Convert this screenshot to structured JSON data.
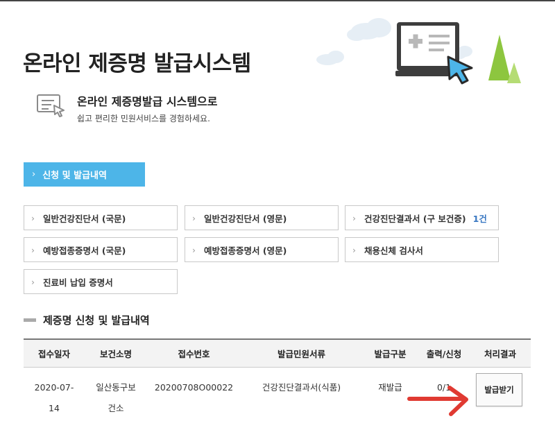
{
  "page": {
    "title": "온라인 제증명 발급시스템"
  },
  "intro": {
    "title": "온라인 제증명발급 시스템으로",
    "subtitle": "쉽고 편리한 민원서비스를 경험하세요."
  },
  "primary_tab": {
    "label": "신청 및 발급내역"
  },
  "certificates": [
    {
      "label": "일반건강진단서 (국문)",
      "count": ""
    },
    {
      "label": "일반건강진단서 (영문)",
      "count": ""
    },
    {
      "label": "건강진단결과서 (구 보건증)",
      "count": "1건"
    },
    {
      "label": "예방접종증명서 (국문)",
      "count": ""
    },
    {
      "label": "예방접종증명서 (영문)",
      "count": ""
    },
    {
      "label": "채용신체 검사서",
      "count": ""
    },
    {
      "label": "진료비 납입 증명서",
      "count": ""
    }
  ],
  "section": {
    "title": "제증명 신청 및 발급내역"
  },
  "table": {
    "headers": [
      "접수일자",
      "보건소명",
      "접수번호",
      "발급민원서류",
      "발급구분",
      "출력/신청",
      "처리결과"
    ],
    "rows": [
      {
        "date_line1": "2020-07-",
        "date_line2": "14",
        "center_line1": "일산동구보",
        "center_line2": "건소",
        "receipt_no": "20200708O00022",
        "document": "건강진단결과서(식품)",
        "issue_type": "재발급",
        "print_ratio": "0/1",
        "action_label": "발급받기"
      }
    ]
  },
  "colors": {
    "accent": "#4db5e8",
    "count": "#3a78c2",
    "arrow": "#e03a32",
    "illustration_green": "#8dc63f"
  },
  "icons": {
    "hero": "computer-cursor-illustration",
    "intro": "document-cursor-icon",
    "chevron": "chevron-right-icon",
    "arrow": "red-arrow-pointer"
  }
}
